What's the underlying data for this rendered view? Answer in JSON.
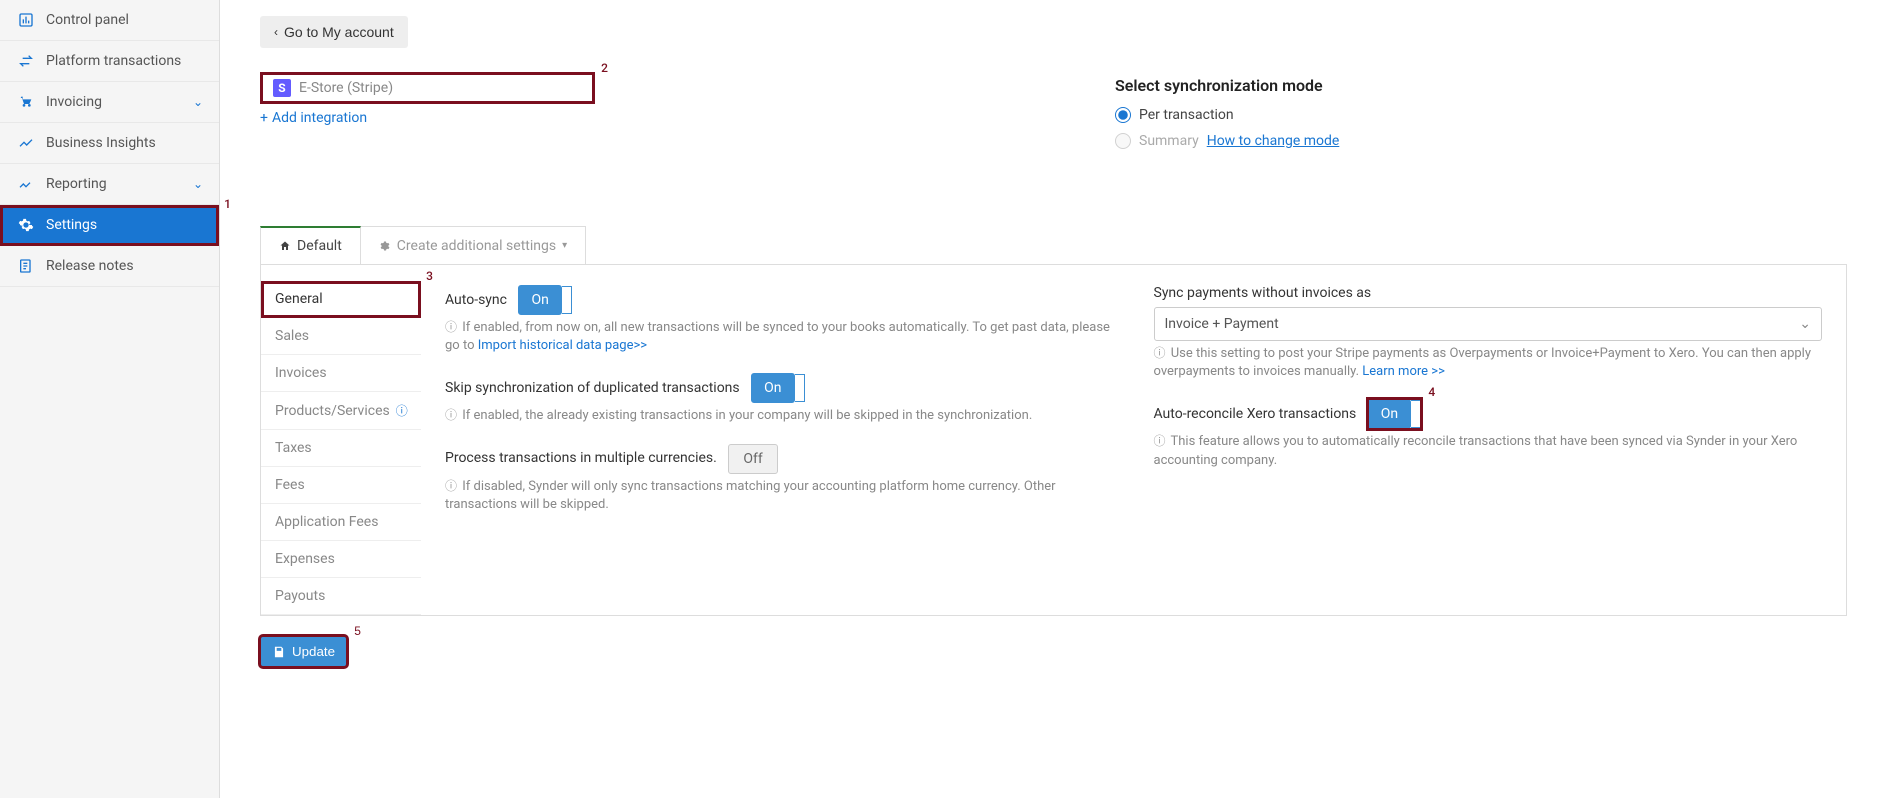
{
  "markers": {
    "m1": "1",
    "m2": "2",
    "m3": "3",
    "m4": "4",
    "m5": "5"
  },
  "sidebar": {
    "items": [
      {
        "label": "Control panel"
      },
      {
        "label": "Platform transactions"
      },
      {
        "label": "Invoicing"
      },
      {
        "label": "Business Insights"
      },
      {
        "label": "Reporting"
      },
      {
        "label": "Settings"
      },
      {
        "label": "Release notes"
      }
    ]
  },
  "back_button": "Go to My account",
  "integration": {
    "name": "E-Store (Stripe)",
    "badge": "S"
  },
  "add_integration": "Add integration",
  "sync_mode": {
    "title": "Select synchronization mode",
    "per_transaction": "Per transaction",
    "summary": "Summary",
    "how_to": "How to change mode"
  },
  "tabs": {
    "default": "Default",
    "create": "Create additional settings"
  },
  "settings_nav": {
    "general": "General",
    "sales": "Sales",
    "invoices": "Invoices",
    "products": "Products/Services",
    "taxes": "Taxes",
    "fees": "Fees",
    "app_fees": "Application Fees",
    "expenses": "Expenses",
    "payouts": "Payouts"
  },
  "left_col": {
    "auto_sync": {
      "label": "Auto-sync",
      "value": "On"
    },
    "auto_sync_help": "If enabled, from now on, all new transactions will be synced to your books automatically. To get past data, please go to ",
    "auto_sync_link": "Import historical data page>>",
    "skip_dup": {
      "label": "Skip synchronization of duplicated transactions",
      "value": "On"
    },
    "skip_dup_help": "If enabled, the already existing transactions in your company will be skipped in the synchronization.",
    "multi_curr": {
      "label": "Process transactions in multiple currencies.",
      "value": "Off"
    },
    "multi_curr_help": "If disabled, Synder will only sync transactions matching your accounting platform home currency. Other transactions will be skipped."
  },
  "right_col": {
    "sync_without": {
      "label": "Sync payments without invoices as",
      "value": "Invoice + Payment"
    },
    "sync_without_help": "Use this setting to post your Stripe payments as Overpayments or Invoice+Payment to Xero. You can then apply overpayments to invoices manually. ",
    "sync_without_link": "Learn more >>",
    "auto_rec": {
      "label": "Auto-reconcile Xero transactions",
      "value": "On"
    },
    "auto_rec_help": "This feature allows you to automatically reconcile transactions that have been synced via Synder in your Xero accounting company."
  },
  "update_button": "Update"
}
